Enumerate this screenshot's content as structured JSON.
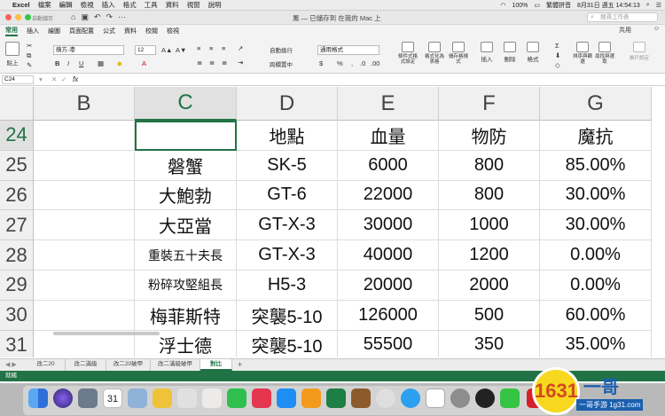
{
  "menubar": {
    "app": "Excel",
    "items": [
      "檔案",
      "編輯",
      "檢視",
      "插入",
      "格式",
      "工具",
      "資料",
      "視窗",
      "說明"
    ],
    "battery": "100%",
    "input_method": "繁體拼音",
    "clock": "8月31日 週五 14:54:13"
  },
  "titlebar": {
    "autosave": "自動儲存",
    "title": "薰 — 已儲存到 在我的 Mac 上",
    "search_placeholder": "搜尋工作表"
  },
  "ribbon_tabs": [
    "常用",
    "插入",
    "繪圖",
    "頁面配置",
    "公式",
    "資料",
    "校閱",
    "檢視"
  ],
  "active_ribbon_tab": "常用",
  "share_label": "共用",
  "ribbon": {
    "paste": "貼上",
    "font_name": "蘋方-港",
    "font_size": "12",
    "wrap_text": "自動換行",
    "merge_center": "跨欄置中",
    "number_format": "通用格式",
    "conditional_format": "條件式格式設定",
    "format_as_table": "格式化為表格",
    "cell_styles": "儲存格樣式",
    "insert": "插入",
    "delete": "刪除",
    "format": "格式",
    "sort_filter": "排序與篩選",
    "find_select": "尋找與選取",
    "feedback": "帳戶設定"
  },
  "formula_bar": {
    "name_box": "C24",
    "fx": "fx",
    "content": ""
  },
  "columns": [
    "B",
    "C",
    "D",
    "E",
    "F",
    "G"
  ],
  "selected_column": "C",
  "rows": [
    {
      "num": "24",
      "cells": [
        "",
        "",
        "地點",
        "血量",
        "物防",
        "魔抗"
      ]
    },
    {
      "num": "25",
      "cells": [
        "",
        "磐蟹",
        "SK-5",
        "6000",
        "800",
        "85.00%"
      ]
    },
    {
      "num": "26",
      "cells": [
        "",
        "大鮑勃",
        "GT-6",
        "22000",
        "800",
        "30.00%"
      ]
    },
    {
      "num": "27",
      "cells": [
        "",
        "大亞當",
        "GT-X-3",
        "30000",
        "1000",
        "30.00%"
      ]
    },
    {
      "num": "28",
      "cells": [
        "",
        "重裝五十夫長",
        "GT-X-3",
        "40000",
        "1200",
        "0.00%"
      ]
    },
    {
      "num": "29",
      "cells": [
        "",
        "粉碎攻堅組長",
        "H5-3",
        "20000",
        "2000",
        "0.00%"
      ]
    },
    {
      "num": "30",
      "cells": [
        "",
        "梅菲斯特",
        "突襲5-10",
        "126000",
        "500",
        "60.00%"
      ]
    },
    {
      "num": "31",
      "cells": [
        "",
        "浮士德",
        "突襲5-10",
        "55500",
        "350",
        "35.00%"
      ]
    }
  ],
  "active_cell": "C24",
  "sheet_tabs": [
    "改二20",
    "改二滿級",
    "改二20破甲",
    "改二滿級破甲",
    "對比"
  ],
  "active_sheet": "對比",
  "status": "就緒",
  "dock": {
    "calendar_day": "31"
  },
  "watermark": {
    "logo": "1631",
    "brand": "一哥",
    "url": "一哥手游 1g31.com"
  },
  "colors": {
    "excel_green": "#217346"
  }
}
